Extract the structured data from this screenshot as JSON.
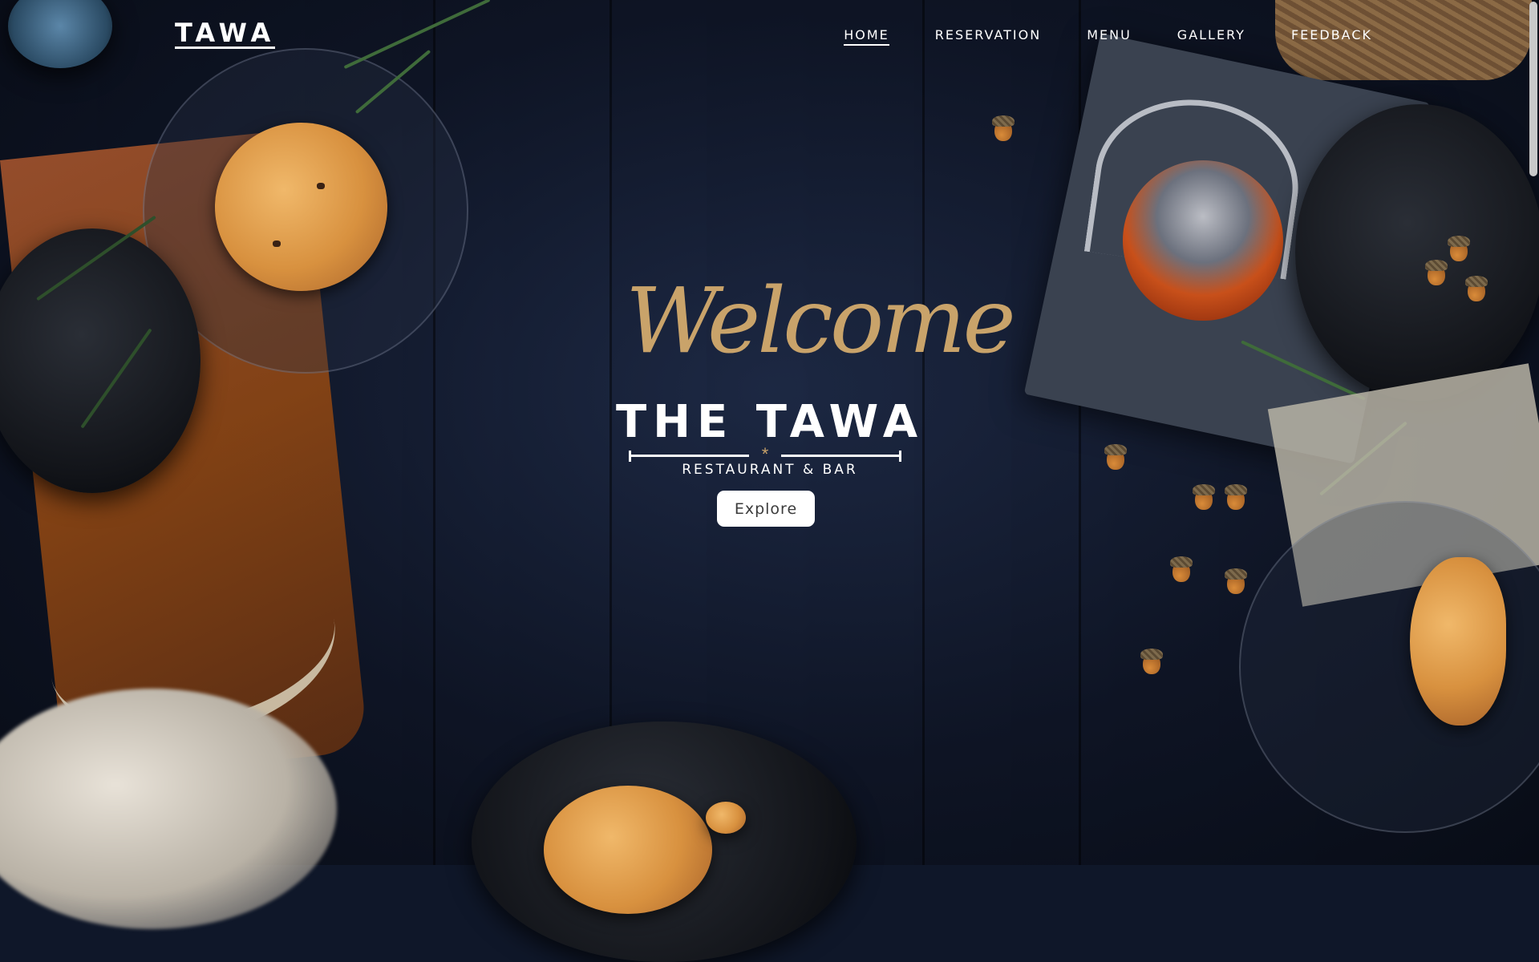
{
  "logo": "TAWA",
  "nav": {
    "items": [
      "HOME",
      "RESERVATION",
      "MENU",
      "GALLERY",
      "FEEDBACK"
    ],
    "active": "HOME"
  },
  "hero": {
    "welcome": "Welcome",
    "brand": "THE TAWA",
    "divider_ornament": "*",
    "tagline": "RESTAURANT & BAR",
    "cta": "Explore"
  },
  "colors": {
    "accent": "#c9a36a",
    "background": "#0f1729",
    "button_bg": "#ffffff"
  }
}
